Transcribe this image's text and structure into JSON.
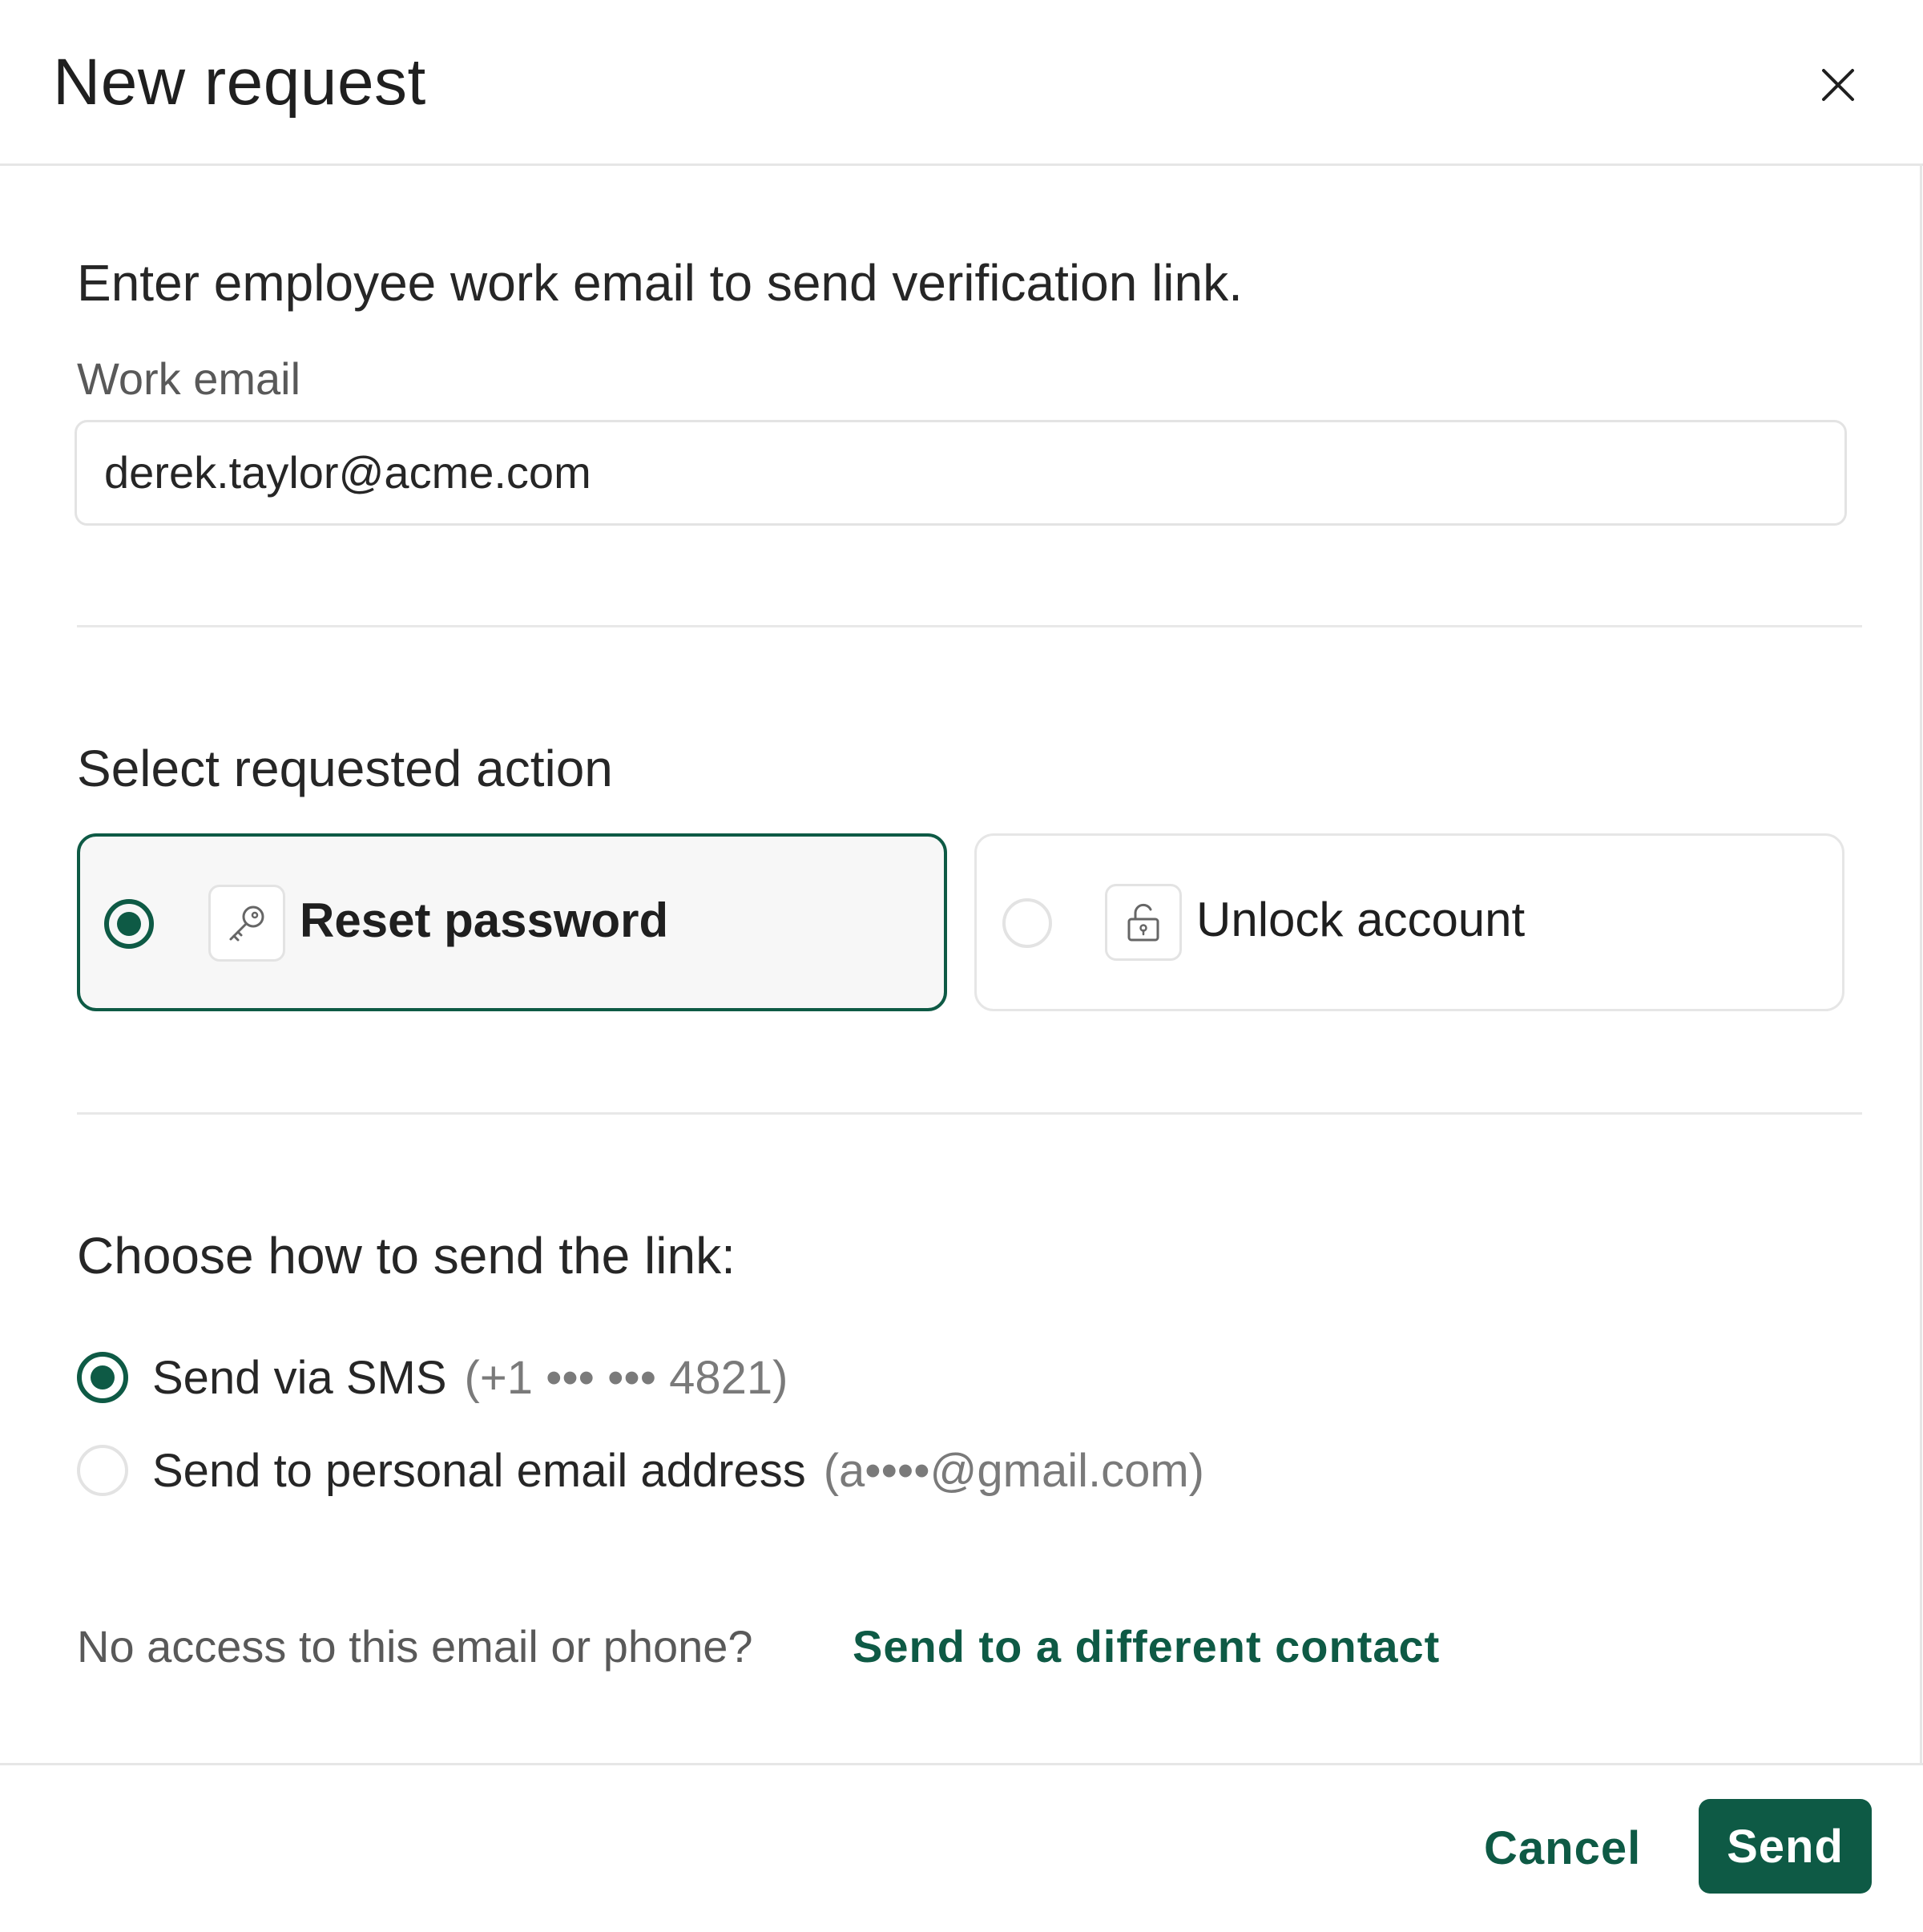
{
  "header": {
    "title": "New request",
    "close_icon": "close-icon"
  },
  "intro_text": "Enter employee work email to send verification link.",
  "email_field": {
    "label": "Work email",
    "value": "derek.taylor@acme.com"
  },
  "action_section": {
    "title": "Select requested action",
    "options": [
      {
        "label": "Reset password",
        "icon": "key-icon",
        "selected": true
      },
      {
        "label": "Unlock account",
        "icon": "unlock-icon",
        "selected": false
      }
    ]
  },
  "send_section": {
    "title": "Choose how to send the link:",
    "options": [
      {
        "label": "Send via SMS",
        "hint": "(+1 ••• ••• 4821)",
        "selected": true
      },
      {
        "label": "Send to personal email address",
        "hint": "(a••••@gmail.com)",
        "selected": false
      }
    ]
  },
  "no_access": {
    "question": "No access to this email or phone?",
    "link": "Send to a different contact"
  },
  "footer": {
    "cancel_label": "Cancel",
    "send_label": "Send"
  },
  "colors": {
    "accent": "#0e5a45",
    "border": "#e3e3e3",
    "muted_text": "#7a7a7a"
  }
}
